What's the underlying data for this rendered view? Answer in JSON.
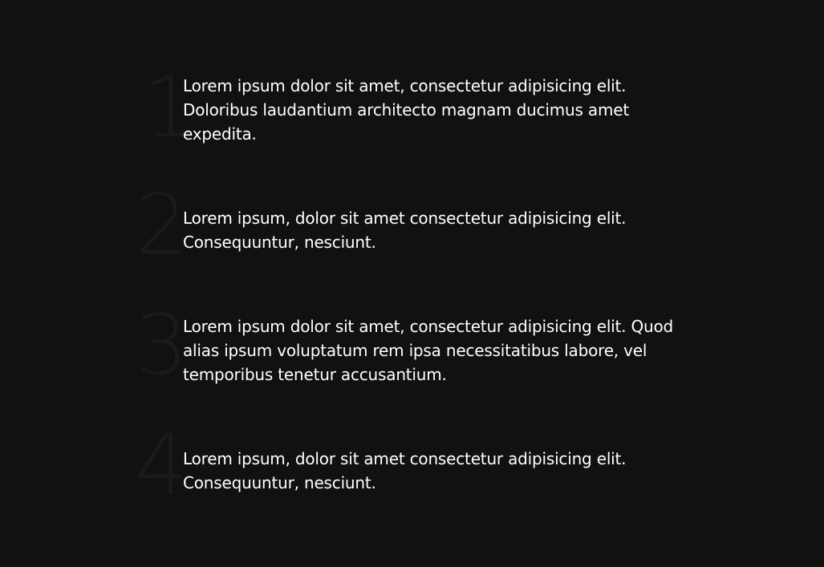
{
  "items": [
    {
      "number": "1",
      "text": "Lorem ipsum dolor sit amet, consectetur adipisicing elit. Doloribus laudantium architecto magnam ducimus amet expedita."
    },
    {
      "number": "2",
      "text": "Lorem ipsum, dolor sit amet consectetur adipisicing elit. Consequuntur, nesciunt."
    },
    {
      "number": "3",
      "text": "Lorem ipsum dolor sit amet, consectetur adipisicing elit. Quod alias ipsum voluptatum rem ipsa necessitatibus labore, vel temporibus tenetur accusantium."
    },
    {
      "number": "4",
      "text": "Lorem ipsum, dolor sit amet consectetur adipisicing elit. Consequuntur, nesciunt."
    }
  ],
  "colors": {
    "background": "#111111",
    "text": "#ffffff",
    "number": "#1a1a1a"
  }
}
